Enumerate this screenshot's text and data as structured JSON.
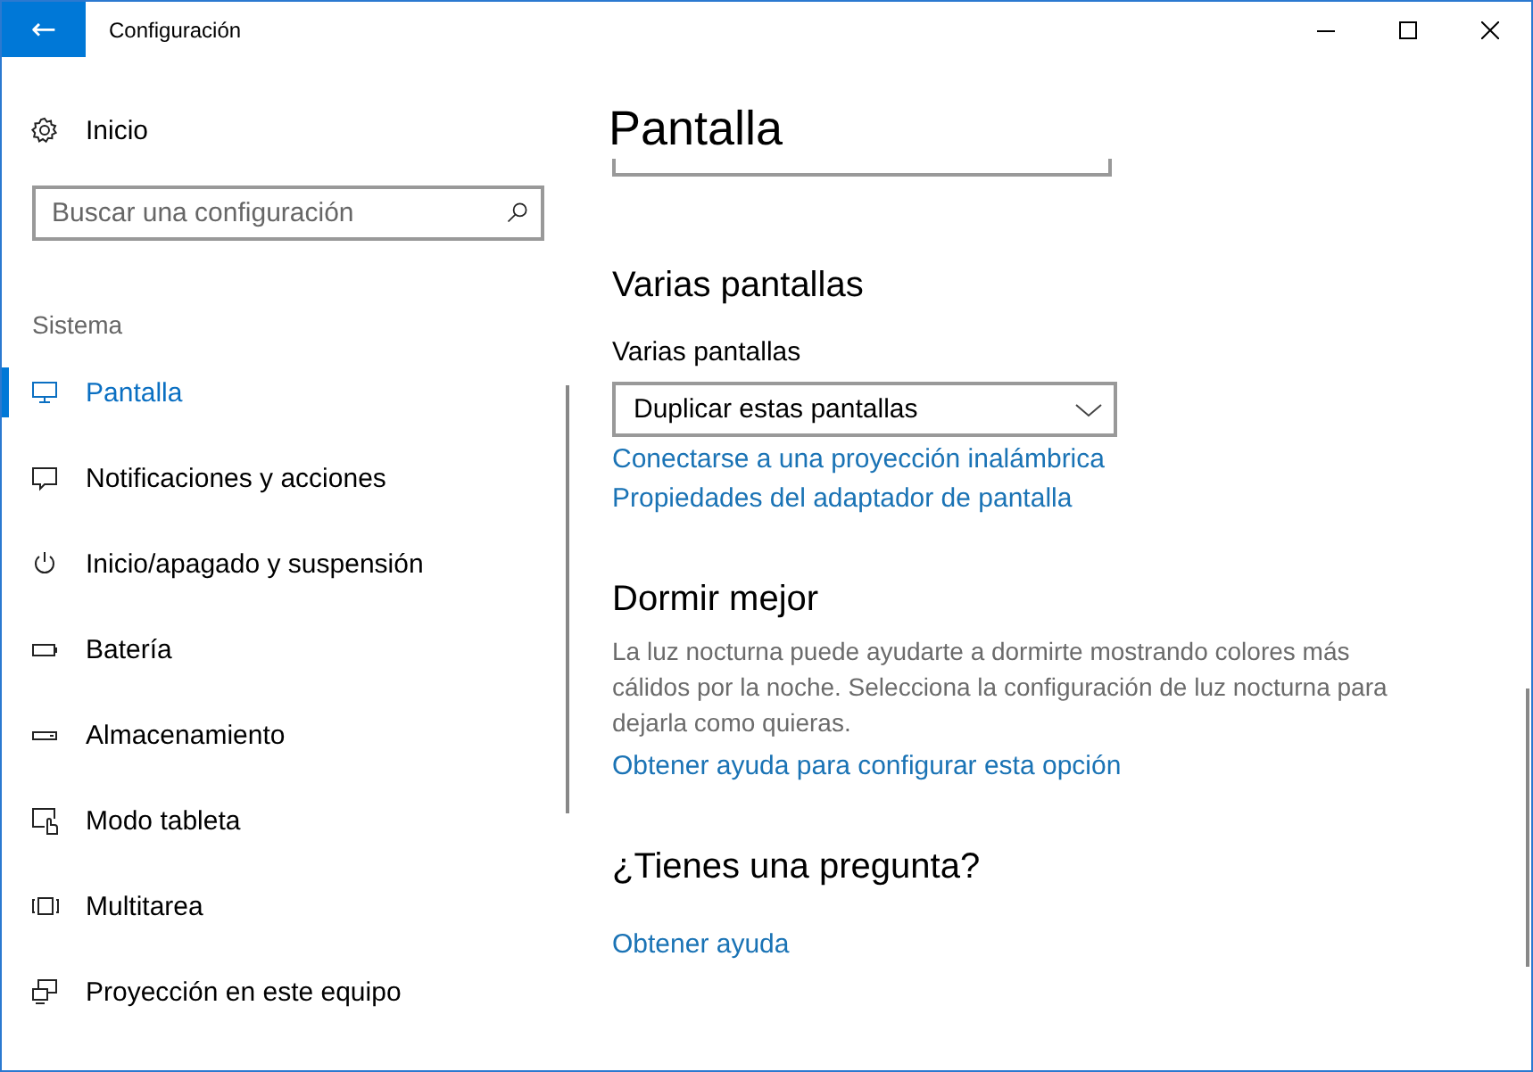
{
  "window": {
    "title": "Configuración",
    "back_button": "←"
  },
  "sidebar": {
    "home": "Inicio",
    "search": {
      "placeholder": "Buscar una configuración"
    },
    "group": "Sistema",
    "items": [
      {
        "label": "Pantalla",
        "kind": "display",
        "selected": true
      },
      {
        "label": "Notificaciones y acciones",
        "kind": "notifications",
        "selected": false
      },
      {
        "label": "Inicio/apagado y suspensión",
        "kind": "power",
        "selected": false
      },
      {
        "label": "Batería",
        "kind": "battery",
        "selected": false
      },
      {
        "label": "Almacenamiento",
        "kind": "storage",
        "selected": false
      },
      {
        "label": "Modo tableta",
        "kind": "tablet",
        "selected": false
      },
      {
        "label": "Multitarea",
        "kind": "multitask",
        "selected": false
      },
      {
        "label": "Proyección en este equipo",
        "kind": "projection",
        "selected": false
      }
    ]
  },
  "content": {
    "title": "Pantalla",
    "sections": [
      {
        "heading": "Varias pantallas",
        "field_label": "Varias pantallas",
        "dropdown": {
          "value": "Duplicar estas pantallas"
        },
        "links": [
          "Conectarse a una proyección inalámbrica",
          "Propiedades del adaptador de pantalla"
        ]
      },
      {
        "heading": "Dormir mejor",
        "description": "La luz nocturna puede ayudarte a dormirte mostrando colores más cálidos por la noche. Selecciona la configuración de luz nocturna para dejarla como quieras.",
        "links": [
          "Obtener ayuda para configurar esta opción"
        ]
      },
      {
        "heading": "¿Tienes una pregunta?",
        "links": [
          "Obtener ayuda"
        ]
      }
    ]
  }
}
